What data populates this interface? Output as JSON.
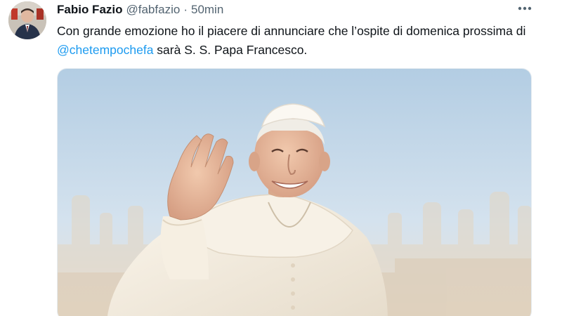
{
  "tweet": {
    "author": {
      "name": "Fabio Fazio",
      "handle": "@fabfazio",
      "avatar_icon": "profile-photo"
    },
    "separator": "·",
    "timestamp": "50min",
    "more_icon": "more-horizontal-icon",
    "text": {
      "part1": "Con grande emozione ho il piacere di annunciare che l’ospite di domenica prossima di ",
      "mention": "@chetempochefa",
      "part2": " sarà S. S. Papa Francesco."
    },
    "media": {
      "type": "photo"
    }
  },
  "colors": {
    "text_primary": "#0f1419",
    "text_secondary": "#536471",
    "link": "#1d9bf0"
  }
}
